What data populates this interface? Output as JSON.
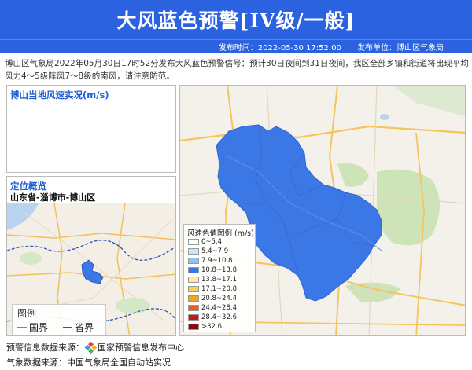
{
  "header": {
    "title": "大风蓝色预警[IV级/一般]",
    "publish_time": "发布时间：2022-05-30 17:52:00",
    "publish_unit": "发布单位：博山区气象局"
  },
  "description": "博山区气象局2022年05月30日17时52分发布大风蓝色预警信号：预计30日夜间到31日夜间，我区全部乡镇和街道将出现平均风力4～5级阵风7～8级的南风，请注意防范。",
  "wind_panel": {
    "title": "博山当地风速实况(m/s)"
  },
  "location_panel": {
    "title": "定位概览",
    "region": "山东省-淄博市-博山区",
    "legend": {
      "title": "图例",
      "items": [
        {
          "label": "国界",
          "color": "#c8647a"
        },
        {
          "label": "省界",
          "color": "#2a52b8"
        }
      ]
    }
  },
  "wind_legend": {
    "title": "风速色值图例 (m/s)",
    "items": [
      {
        "label": "0~5.4",
        "color": "#ffffff"
      },
      {
        "label": "5.4~7.9",
        "color": "#cfe4fb"
      },
      {
        "label": "7.9~10.8",
        "color": "#8fc2f4"
      },
      {
        "label": "10.8~13.8",
        "color": "#3b78e6"
      },
      {
        "label": "13.8~17.1",
        "color": "#fde8a8"
      },
      {
        "label": "17.1~20.8",
        "color": "#fcd15a"
      },
      {
        "label": "20.8~24.4",
        "color": "#f7a21c"
      },
      {
        "label": "24.4~28.4",
        "color": "#ef5b12"
      },
      {
        "label": "28.4~32.6",
        "color": "#c8171a"
      },
      {
        "label": ">32.6",
        "color": "#8a0c10"
      }
    ]
  },
  "footer": {
    "warning_source": "预警信息数据来源：",
    "warning_source_org": "国家预警信息发布中心",
    "weather_source": "气象数据来源：中国气象局全国自动站实况"
  },
  "colors": {
    "header_bg": "#2a62e0",
    "alert_area": "#3b78e6"
  }
}
